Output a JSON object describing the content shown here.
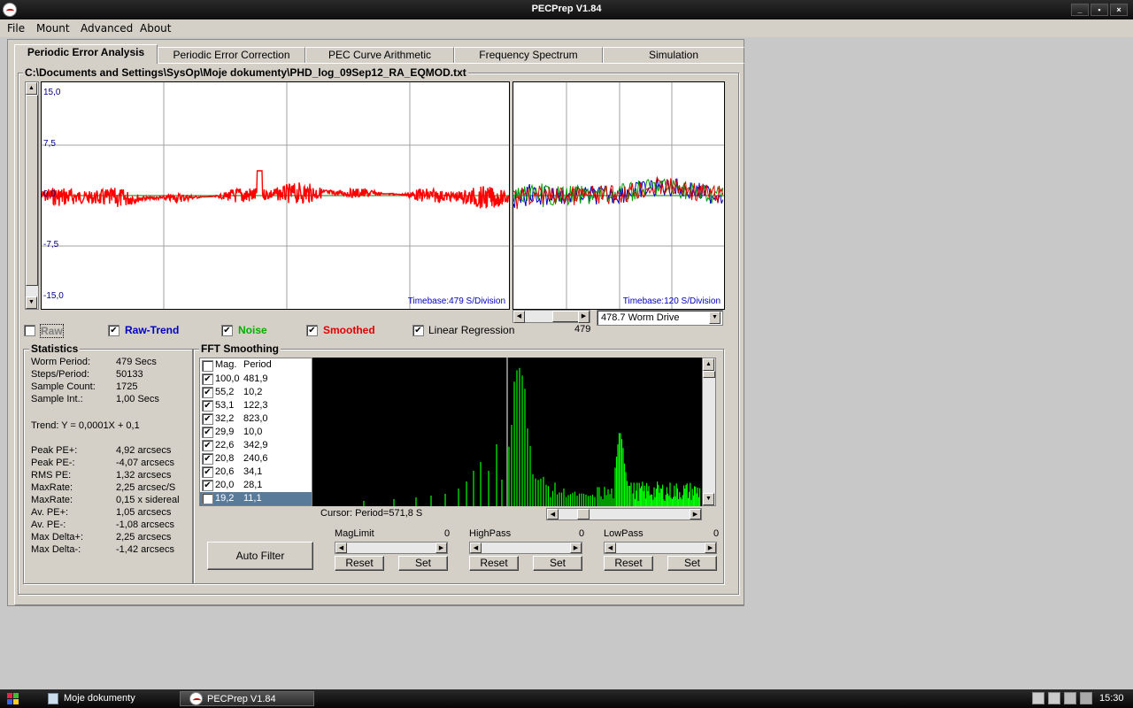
{
  "window": {
    "title": "PECPrep V1.84"
  },
  "menu": [
    "File",
    "Mount",
    "Advanced",
    "About"
  ],
  "tabs": [
    "Periodic Error Analysis",
    "Periodic Error Correction",
    "PEC Curve Arithmetic",
    "Frequency Spectrum",
    "Simulation"
  ],
  "active_tab": 0,
  "file_path": "C:\\Documents and Settings\\SysOp\\Moje dokumenty\\PHD_log_09Sep12_RA_EQMOD.txt",
  "main_plot": {
    "y_ticks": [
      "15,0",
      "7,5",
      "0,0",
      "-7,5",
      "-15,0"
    ],
    "timebase": "Timebase:479 S/Division",
    "colors": {
      "series": "#ff0000",
      "trend": "#008000",
      "axis": "#000080"
    }
  },
  "side_plot": {
    "timebase": "Timebase:120 S/Division"
  },
  "side_scroll_value": "479",
  "worm_select": "478.7 Worm Drive",
  "checkboxes": [
    {
      "label": "Raw",
      "checked": false,
      "color": "#808080"
    },
    {
      "label": "Raw-Trend",
      "checked": true,
      "color": "#0000c0"
    },
    {
      "label": "Noise",
      "checked": true,
      "color": "#00b000"
    },
    {
      "label": "Smoothed",
      "checked": true,
      "color": "#e00000"
    },
    {
      "label": "Linear Regression",
      "checked": true,
      "color": "#000000"
    }
  ],
  "statistics": {
    "title": "Statistics",
    "rows": [
      {
        "k": "Worm Period:",
        "v": "479 Secs"
      },
      {
        "k": "Steps/Period:",
        "v": "50133"
      },
      {
        "k": "Sample Count:",
        "v": "1725"
      },
      {
        "k": "Sample Int.:",
        "v": "1,00 Secs"
      }
    ],
    "trend": "Trend: Y = 0,0001X + 0,1",
    "pe_rows": [
      {
        "k": "Peak PE+:",
        "v": "4,92 arcsecs"
      },
      {
        "k": "Peak PE-:",
        "v": "-4,07 arcsecs"
      },
      {
        "k": "RMS PE:",
        "v": "1,32 arcsecs"
      },
      {
        "k": "MaxRate:",
        "v": "2,25 arcsec/S"
      },
      {
        "k": "MaxRate:",
        "v": "0,15 x sidereal"
      },
      {
        "k": "Av. PE+:",
        "v": "1,05 arcsecs"
      },
      {
        "k": "Av. PE-:",
        "v": "-1,08 arcsecs"
      },
      {
        "k": "Max Delta+:",
        "v": "2,25 arcsecs"
      },
      {
        "k": "Max Delta-:",
        "v": "-1,42 arcsecs"
      }
    ]
  },
  "fft": {
    "title": "FFT Smoothing",
    "header": {
      "mag": "Mag.",
      "period": "Period"
    },
    "rows": [
      {
        "mag": "100,0",
        "period": "481,9",
        "checked": true
      },
      {
        "mag": "55,2",
        "period": "10,2",
        "checked": true
      },
      {
        "mag": "53,1",
        "period": "122,3",
        "checked": true
      },
      {
        "mag": "32,2",
        "period": "823,0",
        "checked": true
      },
      {
        "mag": "29,9",
        "period": "10,0",
        "checked": true
      },
      {
        "mag": "22,6",
        "period": "342,9",
        "checked": true
      },
      {
        "mag": "20,8",
        "period": "240,6",
        "checked": true
      },
      {
        "mag": "20,6",
        "period": "34,1",
        "checked": true
      },
      {
        "mag": "20,0",
        "period": "28,1",
        "checked": true
      },
      {
        "mag": "19,2",
        "period": "11,1",
        "checked": true,
        "selected": true
      }
    ],
    "cursor": "Cursor: Period=571,8 S",
    "auto_filter": "Auto Filter",
    "filters": [
      {
        "name": "MagLimit",
        "value": "0",
        "reset": "Reset",
        "set": "Set"
      },
      {
        "name": "HighPass",
        "value": "0",
        "reset": "Reset",
        "set": "Set"
      },
      {
        "name": "LowPass",
        "value": "0",
        "reset": "Reset",
        "set": "Set"
      }
    ]
  },
  "taskbar": {
    "items": [
      "Moje dokumenty",
      "PECPrep V1.84"
    ],
    "clock": "15:30"
  }
}
